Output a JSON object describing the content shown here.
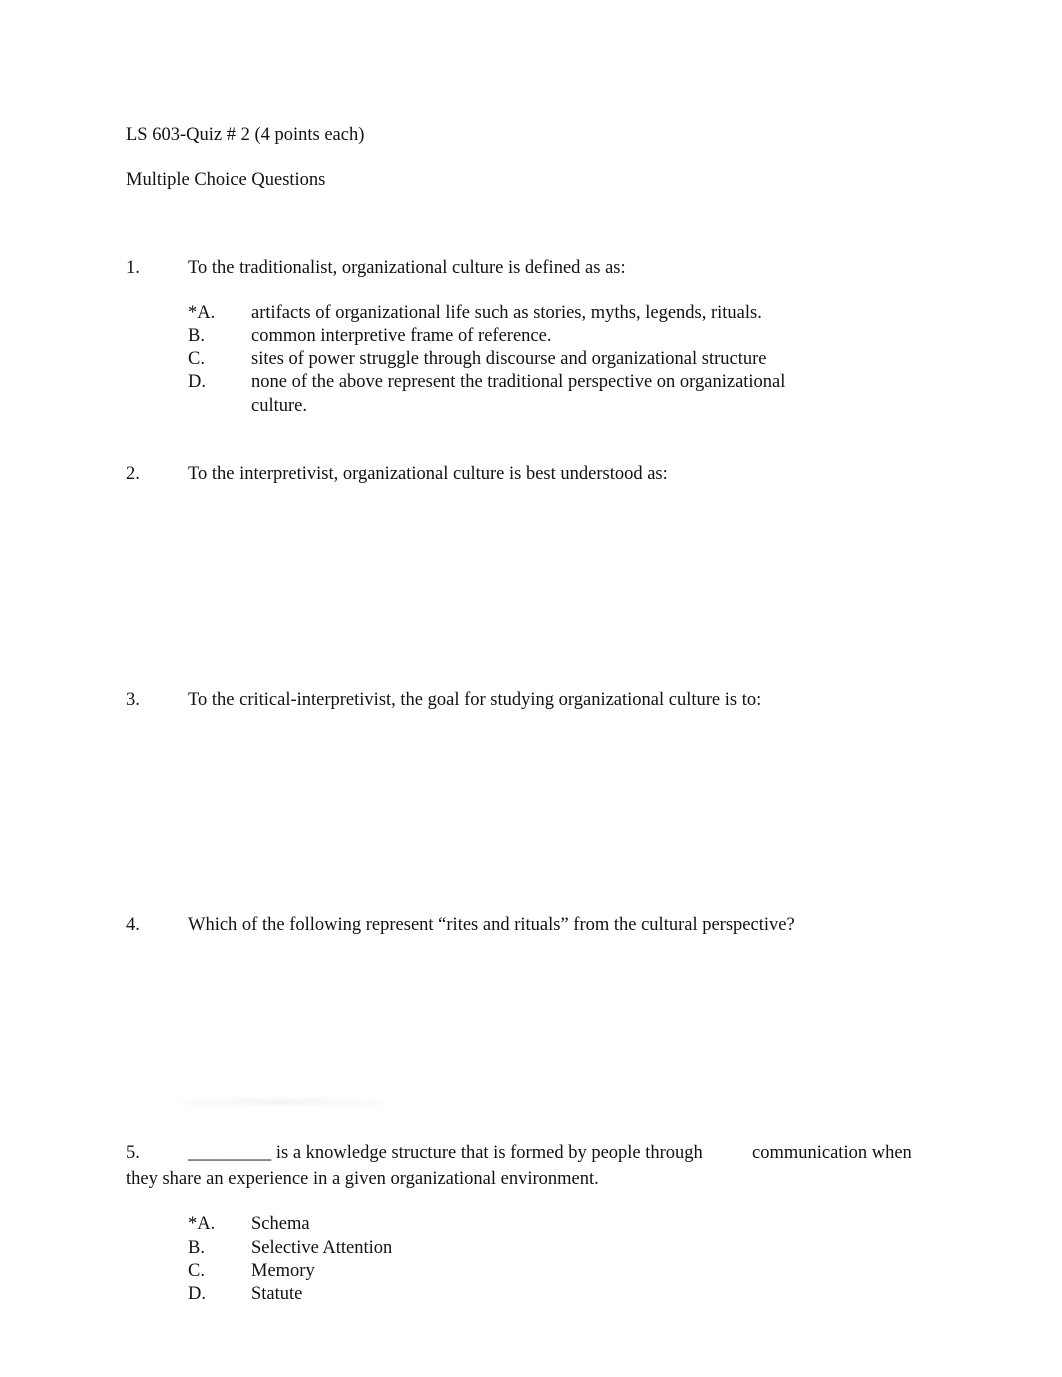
{
  "header": {
    "title": "LS 603-Quiz # 2 (4 points each)",
    "subtitle": "Multiple Choice Questions"
  },
  "questions": [
    {
      "number": "1.",
      "text": "To the traditionalist, organizational culture is defined as as:",
      "options": [
        {
          "letter": "*A.",
          "text": "artifacts of organizational life such as stories, myths, legends, rituals.",
          "correct": true
        },
        {
          "letter": "B.",
          "text": "common interpretive frame of reference.",
          "correct": false
        },
        {
          "letter": "C.",
          "text": "sites of power struggle through discourse and organizational structure",
          "correct": false
        },
        {
          "letter": "D.",
          "text": "none of the above represent the traditional perspective on organizational",
          "text_cont": "culture.",
          "correct": false
        }
      ]
    },
    {
      "number": "2.",
      "text": "To the interpretivist, organizational culture is best understood as:",
      "options": []
    },
    {
      "number": "3.",
      "text": "To the critical-interpretivist, the goal for studying organizational culture is to:",
      "options": []
    },
    {
      "number": "4.",
      "text": "Which of the following represent “rites and rituals” from the cultural perspective?",
      "options": []
    },
    {
      "number": "5.",
      "blank": "_________",
      "text_line1": " is a knowledge structure that is formed by people through",
      "text_line1_cont": "communication when",
      "text_line2": "they share an experience in a given organizational environment.",
      "options": [
        {
          "letter": "*A.",
          "text": "Schema",
          "correct": true
        },
        {
          "letter": "B.",
          "text": "Selective Attention",
          "correct": false
        },
        {
          "letter": "C.",
          "text": "Memory",
          "correct": false
        },
        {
          "letter": "D.",
          "text": "Statute",
          "correct": false
        }
      ]
    }
  ]
}
